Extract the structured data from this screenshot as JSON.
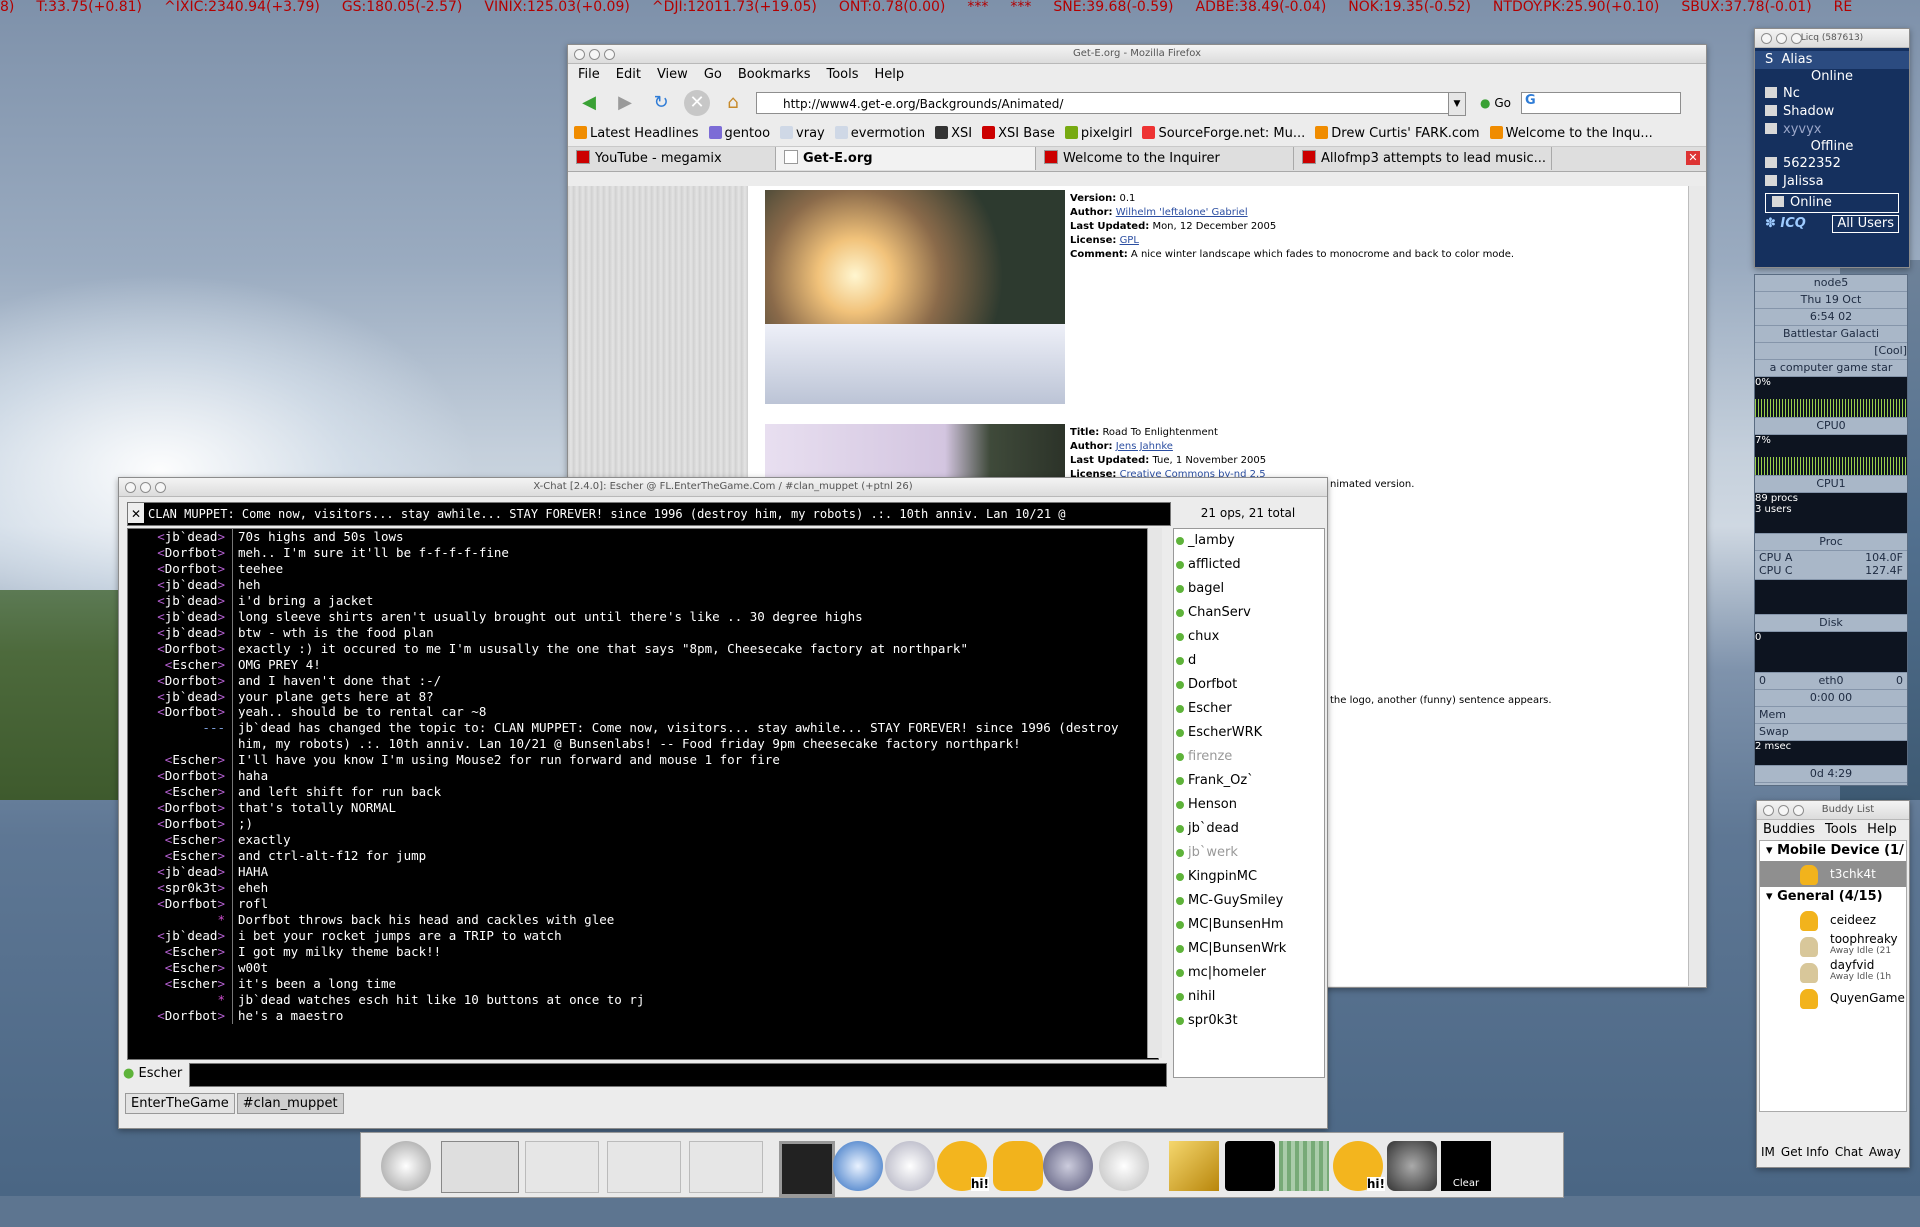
{
  "ticker": [
    "8)",
    "T:33.75(+0.81)",
    "^IXIC:2340.94(+3.79)",
    "GS:180.05(-2.57)",
    "VINIX:125.03(+0.09)",
    "^DJI:12011.73(+19.05)",
    "ONT:0.78(0.00)",
    "***",
    "***",
    "SNE:39.68(-0.59)",
    "ADBE:38.49(-0.04)",
    "NOK:19.35(-0.52)",
    "NTDOY.PK:25.90(+0.10)",
    "SBUX:37.78(-0.01)",
    "RE"
  ],
  "firefox": {
    "title": "Get-E.org - Mozilla Firefox",
    "menu": [
      "File",
      "Edit",
      "View",
      "Go",
      "Bookmarks",
      "Tools",
      "Help"
    ],
    "url": "http://www4.get-e.org/Backgrounds/Animated/",
    "go_label": "Go",
    "bookmarks": [
      "Latest Headlines",
      "gentoo",
      "vray",
      "evermotion",
      "XSI",
      "XSI Base",
      "pixelgirl",
      "SourceForge.net: Mu...",
      "Drew Curtis' FARK.com",
      "Welcome to the Inqu..."
    ],
    "tabs": [
      "YouTube - megamix",
      "Get-E.org",
      "Welcome to the Inquirer",
      "Allofmp3 attempts to lead music..."
    ],
    "item1": {
      "version_label": "Version:",
      "version": "0.1",
      "author_label": "Author:",
      "author": "Wilhelm 'leftalone' Gabriel",
      "updated_label": "Last Updated:",
      "updated": "Mon, 12 December 2005",
      "license_label": "License:",
      "license": "GPL",
      "comment_label": "Comment:",
      "comment": "A nice winter landscape which fades to monocrome and back to color mode."
    },
    "item2": {
      "title_label": "Title:",
      "title": "Road To Enlightenment",
      "author_label": "Author:",
      "author": "Jens Jahnke",
      "updated_label": "Last Updated:",
      "updated": "Tue, 1 November 2005",
      "license_label": "License:",
      "license": "Creative Commons by-nd 2.5"
    },
    "fragment1": "nimated version.",
    "fragment2": "the logo, another (funny) sentence appears."
  },
  "xchat": {
    "title": "X-Chat [2.4.0]: Escher @ FL.EnterTheGame.Com / #clan_muppet (+ptnl 26)",
    "topic": "CLAN MUPPET: Come now, visitors... stay awhile... STAY FOREVER! since 1996 (destroy him, my robots) .:. 10th anniv. Lan 10/21 @",
    "user_count": "21 ops, 21 total",
    "log": [
      {
        "nick": "jb`dead",
        "text": "70s highs and 50s lows"
      },
      {
        "nick": "Dorfbot",
        "text": "meh.. I'm sure it'll be f-f-f-f-fine"
      },
      {
        "nick": "Dorfbot",
        "text": "teehee"
      },
      {
        "nick": "jb`dead",
        "text": "heh"
      },
      {
        "nick": "jb`dead",
        "text": "i'd bring a jacket"
      },
      {
        "nick": "jb`dead",
        "text": "long sleeve shirts aren't usually brought out until there's like .. 30 degree highs"
      },
      {
        "nick": "jb`dead",
        "text": "btw - wth is the food plan"
      },
      {
        "nick": "Dorfbot",
        "text": "exactly :) it occured to me I'm ususally the one that says \"8pm, Cheesecake factory at northpark\""
      },
      {
        "nick": "Escher",
        "text": "OMG PREY 4!"
      },
      {
        "nick": "Dorfbot",
        "text": "and I haven't done that :-/"
      },
      {
        "nick": "jb`dead",
        "text": "your plane gets here at 8?"
      },
      {
        "nick": "Dorfbot",
        "text": "yeah.. should be to rental car ~8"
      },
      {
        "nick": "---",
        "text": "jb`dead has changed the topic to: CLAN MUPPET: Come now, visitors... stay awhile... STAY FOREVER! since 1996 (destroy him, my robots) .:. 10th anniv. Lan 10/21 @ Bunsenlabs! -- Food friday 9pm cheesecake factory northpark!"
      },
      {
        "nick": "Escher",
        "text": "I'll have you know I'm using Mouse2 for run forward and mouse 1 for fire"
      },
      {
        "nick": "Dorfbot",
        "text": "haha"
      },
      {
        "nick": "Escher",
        "text": "and left shift for run back"
      },
      {
        "nick": "Dorfbot",
        "text": "that's totally NORMAL"
      },
      {
        "nick": "Dorfbot",
        "text": ";)"
      },
      {
        "nick": "Escher",
        "text": "exactly"
      },
      {
        "nick": "Escher",
        "text": "and ctrl-alt-f12 for jump"
      },
      {
        "nick": "jb`dead",
        "text": "HAHA"
      },
      {
        "nick": "spr0k3t",
        "text": "eheh"
      },
      {
        "nick": "Dorfbot",
        "text": "rofl"
      },
      {
        "nick": "*",
        "text": "Dorfbot throws back his head and cackles with glee"
      },
      {
        "nick": "jb`dead",
        "text": "i bet your rocket jumps are a TRIP to watch"
      },
      {
        "nick": "Escher",
        "text": "I got my milky theme back!!"
      },
      {
        "nick": "Escher",
        "text": "w00t"
      },
      {
        "nick": "Escher",
        "text": "it's been a long time"
      },
      {
        "nick": "*",
        "text": "jb`dead watches esch hit like 10 buttons at once to rj"
      },
      {
        "nick": "Dorfbot",
        "text": "he's a maestro"
      }
    ],
    "users": [
      {
        "name": "_lamby",
        "away": false
      },
      {
        "name": "afflicted",
        "away": false
      },
      {
        "name": "bagel",
        "away": false
      },
      {
        "name": "ChanServ",
        "away": false
      },
      {
        "name": "chux",
        "away": false
      },
      {
        "name": "d",
        "away": false
      },
      {
        "name": "Dorfbot",
        "away": false
      },
      {
        "name": "Escher",
        "away": false
      },
      {
        "name": "EscherWRK",
        "away": false
      },
      {
        "name": "firenze",
        "away": true
      },
      {
        "name": "Frank_Oz`",
        "away": false
      },
      {
        "name": "Henson",
        "away": false
      },
      {
        "name": "jb`dead",
        "away": false
      },
      {
        "name": "jb`werk",
        "away": true
      },
      {
        "name": "KingpinMC",
        "away": false
      },
      {
        "name": "MC-GuySmiley",
        "away": false
      },
      {
        "name": "MC|BunsenHm",
        "away": false
      },
      {
        "name": "MC|BunsenWrk",
        "away": false
      },
      {
        "name": "mc|homeler",
        "away": false
      },
      {
        "name": "nihil",
        "away": false
      },
      {
        "name": "spr0k3t",
        "away": false
      }
    ],
    "my_nick": "Escher",
    "server_tabs": [
      "EnterTheGame",
      "#clan_muppet"
    ]
  },
  "licq": {
    "title": "Licq (587613)",
    "alias_label": "Alias",
    "online_header": "Online",
    "online": [
      "Nc",
      "Shadow",
      "xyvyx"
    ],
    "offline_header": "Offline",
    "offline": [
      "5622352",
      "Jalissa"
    ],
    "status": "Online",
    "icq_label": "ICQ",
    "all_users": "All Users"
  },
  "gkrellm": {
    "host": "node5",
    "date": "Thu 19 Oct",
    "time": "6:54 02",
    "line1": "Battlestar Galacti",
    "line2": "[Cool]",
    "line3": "a computer game star",
    "cpu0_pct": "0%",
    "cpu0": "CPU0",
    "cpu1_pct": "7%",
    "cpu1": "CPU1",
    "procs": "89 procs",
    "users": "3 users",
    "proc": "Proc",
    "temp_a": "CPU A",
    "temp_a_val": "104.0F",
    "temp_c": "CPU C",
    "temp_c_val": "127.4F",
    "disk": "Disk",
    "disk_val": "0",
    "eth_left": "0",
    "eth": "eth0",
    "eth_right": "0",
    "eth_time": "0:00 00",
    "mem": "Mem",
    "swap": "Swap",
    "msec": "2 msec",
    "uptime": "0d 4:29"
  },
  "pidgin": {
    "title": "Buddy List",
    "menu": [
      "Buddies",
      "Tools",
      "Help"
    ],
    "group1": "Mobile Device (1/",
    "mobile_buddy": "t3chk4t",
    "group2": "General (4/15)",
    "buddies": [
      {
        "name": "ceideez",
        "sub": ""
      },
      {
        "name": "toophreaky",
        "sub": "Away Idle (21"
      },
      {
        "name": "dayfvid",
        "sub": "Away Idle (1h"
      },
      {
        "name": "QuyenGame",
        "sub": ""
      }
    ],
    "bottom": [
      "IM",
      "Get Info",
      "Chat",
      "Away"
    ]
  },
  "dock": {
    "weather": "Clear",
    "hi": "hi!"
  }
}
